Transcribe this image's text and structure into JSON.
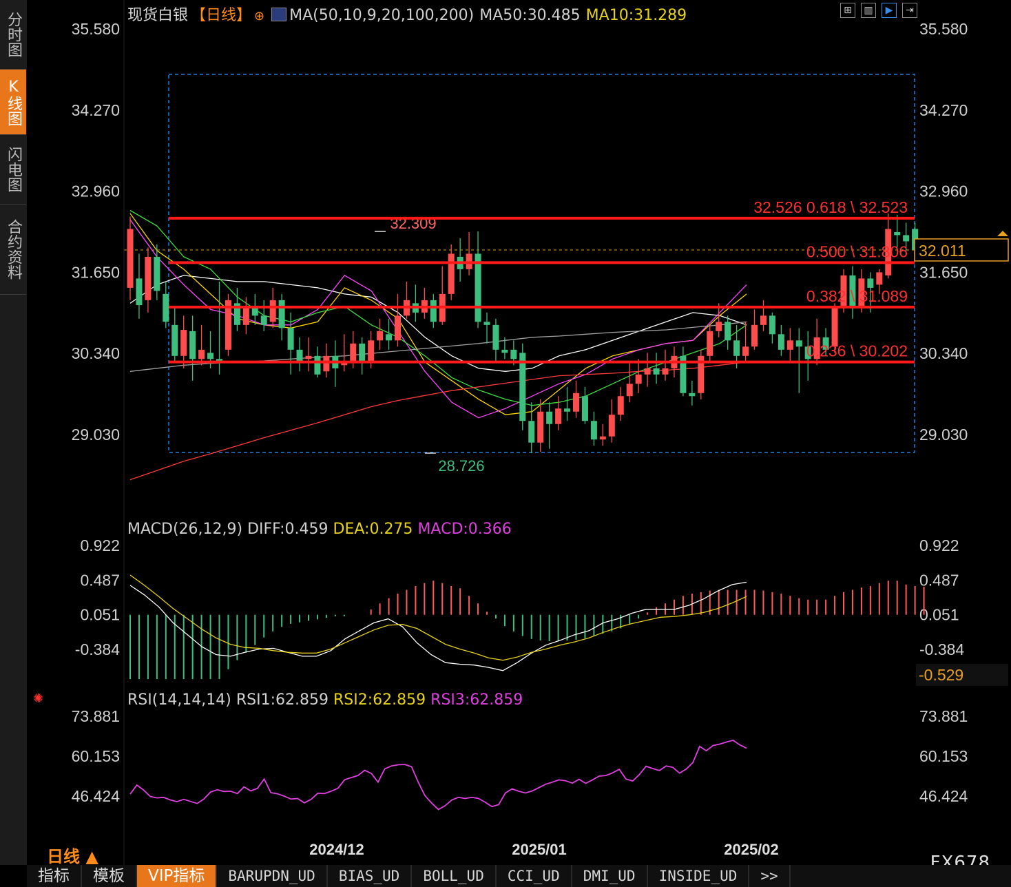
{
  "sidebar": {
    "tabs": [
      {
        "label": "分时图",
        "active": false
      },
      {
        "label": "K线图",
        "active": true
      },
      {
        "label": "闪电图",
        "active": false
      },
      {
        "label": "合约资料",
        "active": false
      }
    ]
  },
  "header": {
    "instrument": "现货白银",
    "period_bracket": "【日线】",
    "ma_params": "MA(50,10,9,20,100,200)",
    "ma50": "MA50:30.485",
    "ma10": "MA10:31.289"
  },
  "toolbar_icons": [
    "grid-icon",
    "bar-chart-icon",
    "play-icon",
    "step-forward-icon"
  ],
  "price_panel": {
    "y_ticks": [
      "35.580",
      "34.270",
      "32.960",
      "31.650",
      "30.340",
      "29.030"
    ],
    "current_price": "32.011",
    "high_label": "32.309",
    "low_label": "28.726",
    "fib_levels": [
      {
        "text": "32.526 0.618 \\ 32.523",
        "value": 32.523
      },
      {
        "text": "0.500 \\ 31.806",
        "value": 31.806
      },
      {
        "text": "0.382 \\ 31.089",
        "value": 31.089
      },
      {
        "text": "0.236 \\ 30.202",
        "value": 30.202
      }
    ],
    "colors": {
      "up": "#ff4d4d",
      "down": "#3fbf7f",
      "fib": "#ff1a1a",
      "frame": "#1f7fe0"
    }
  },
  "macd_panel": {
    "title": "MACD(26,12,9)",
    "diff": "DIFF:0.459",
    "dea": "DEA:0.275",
    "macd": "MACD:0.366",
    "y_ticks": [
      "0.922",
      "0.487",
      "0.051",
      "-0.384"
    ],
    "readout": "-0.529"
  },
  "rsi_panel": {
    "title": "RSI(14,14,14)",
    "rsi1": "RSI1:62.859",
    "rsi2": "RSI2:62.859",
    "rsi3": "RSI3:62.859",
    "y_ticks": [
      "73.881",
      "60.153",
      "46.424"
    ]
  },
  "x_labels": [
    "2024/12",
    "2025/01",
    "2025/02"
  ],
  "period_label": "日线 ▲",
  "bottom_tabs": [
    "指标",
    "模板",
    "VIP指标",
    "BARUPDN_UD",
    "BIAS_UD",
    "BOLL_UD",
    "CCI_UD",
    "DMI_UD",
    "INSIDE_UD",
    ">>"
  ],
  "watermark": "FX678",
  "chart_data": {
    "type": "candlestick",
    "ylim": [
      28.3,
      35.8
    ],
    "candles": [
      [
        31.4,
        32.35,
        32.55,
        31.2
      ],
      [
        31.55,
        31.12,
        31.95,
        30.9
      ],
      [
        31.2,
        31.9,
        32.05,
        31.0
      ],
      [
        31.9,
        31.35,
        32.1,
        31.2
      ],
      [
        31.3,
        30.85,
        31.5,
        30.75
      ],
      [
        30.8,
        30.3,
        31.1,
        30.2
      ],
      [
        30.3,
        30.72,
        30.95,
        30.1
      ],
      [
        30.7,
        30.25,
        30.95,
        29.9
      ],
      [
        30.25,
        30.4,
        30.8,
        30.15
      ],
      [
        30.35,
        30.25,
        30.7,
        30.1
      ],
      [
        30.25,
        30.2,
        31.5,
        30.0
      ],
      [
        30.4,
        31.2,
        31.3,
        30.3
      ],
      [
        31.15,
        30.8,
        31.4,
        30.7
      ],
      [
        30.8,
        31.1,
        31.25,
        30.65
      ],
      [
        31.1,
        30.95,
        31.3,
        30.8
      ],
      [
        30.95,
        30.8,
        31.2,
        30.7
      ],
      [
        30.85,
        31.2,
        31.4,
        30.75
      ],
      [
        31.2,
        30.75,
        31.3,
        30.55
      ],
      [
        30.75,
        30.4,
        31.0,
        30.0
      ],
      [
        30.4,
        30.2,
        30.6,
        30.05
      ],
      [
        30.25,
        30.3,
        30.6,
        30.05
      ],
      [
        30.3,
        30.0,
        30.45,
        29.95
      ],
      [
        30.05,
        30.3,
        30.5,
        29.95
      ],
      [
        30.3,
        30.1,
        30.55,
        29.8
      ],
      [
        30.15,
        30.2,
        30.65,
        30.05
      ],
      [
        30.2,
        30.5,
        30.7,
        30.1
      ],
      [
        30.5,
        30.2,
        30.6,
        30.0
      ],
      [
        30.2,
        30.55,
        30.7,
        30.1
      ],
      [
        30.55,
        30.7,
        30.9,
        30.4
      ],
      [
        30.65,
        30.55,
        30.9,
        30.4
      ],
      [
        30.55,
        30.95,
        31.3,
        30.45
      ],
      [
        30.95,
        31.2,
        31.5,
        30.9
      ],
      [
        31.15,
        31.0,
        31.45,
        30.85
      ],
      [
        31.0,
        31.2,
        31.4,
        30.9
      ],
      [
        31.2,
        30.85,
        31.3,
        30.75
      ],
      [
        30.85,
        31.3,
        31.75,
        30.8
      ],
      [
        31.3,
        31.95,
        32.1,
        31.2
      ],
      [
        31.9,
        31.7,
        32.2,
        31.5
      ],
      [
        31.7,
        31.95,
        32.3,
        31.6
      ],
      [
        31.95,
        30.85,
        32.31,
        30.75
      ],
      [
        30.85,
        30.8,
        31.0,
        30.5
      ],
      [
        30.8,
        30.4,
        30.9,
        30.2
      ],
      [
        30.4,
        30.35,
        30.6,
        30.25
      ],
      [
        30.4,
        30.25,
        30.55,
        30.15
      ],
      [
        30.35,
        29.25,
        30.5,
        29.1
      ],
      [
        29.25,
        28.9,
        29.55,
        28.73
      ],
      [
        28.9,
        29.4,
        29.6,
        28.75
      ],
      [
        29.4,
        29.2,
        29.55,
        28.8
      ],
      [
        29.2,
        29.45,
        29.65,
        29.1
      ],
      [
        29.45,
        29.4,
        29.8,
        29.25
      ],
      [
        29.4,
        29.7,
        29.9,
        29.3
      ],
      [
        29.65,
        29.25,
        29.8,
        29.2
      ],
      [
        29.25,
        28.95,
        29.4,
        28.85
      ],
      [
        28.95,
        29.0,
        29.2,
        28.85
      ],
      [
        29.0,
        29.35,
        29.6,
        28.9
      ],
      [
        29.35,
        29.65,
        29.8,
        29.25
      ],
      [
        29.65,
        29.85,
        30.2,
        29.55
      ],
      [
        29.85,
        30.0,
        30.25,
        29.7
      ],
      [
        30.0,
        30.1,
        30.35,
        29.8
      ],
      [
        30.1,
        30.0,
        30.35,
        29.85
      ],
      [
        30.0,
        30.1,
        30.4,
        29.9
      ],
      [
        30.1,
        30.3,
        30.45,
        29.95
      ],
      [
        30.3,
        29.7,
        30.45,
        29.65
      ],
      [
        29.7,
        29.65,
        29.9,
        29.5
      ],
      [
        29.7,
        30.3,
        30.4,
        29.6
      ],
      [
        30.3,
        30.7,
        30.8,
        30.2
      ],
      [
        30.7,
        30.85,
        31.15,
        30.6
      ],
      [
        30.85,
        30.55,
        30.95,
        30.4
      ],
      [
        30.55,
        30.3,
        30.8,
        30.1
      ],
      [
        30.3,
        30.45,
        30.85,
        30.2
      ],
      [
        30.45,
        30.8,
        31.05,
        30.4
      ],
      [
        30.8,
        30.95,
        31.2,
        30.7
      ],
      [
        30.95,
        30.65,
        31.0,
        30.5
      ],
      [
        30.65,
        30.4,
        30.8,
        30.3
      ],
      [
        30.4,
        30.55,
        30.75,
        30.2
      ],
      [
        30.55,
        30.45,
        30.75,
        29.7
      ],
      [
        30.45,
        30.25,
        30.7,
        29.9
      ],
      [
        30.25,
        30.6,
        30.9,
        30.15
      ],
      [
        30.6,
        30.4,
        30.75,
        30.3
      ],
      [
        30.45,
        31.1,
        31.15,
        30.35
      ],
      [
        31.1,
        31.6,
        31.7,
        31.0
      ],
      [
        31.6,
        31.1,
        31.75,
        30.9
      ],
      [
        31.1,
        31.55,
        31.7,
        31.0
      ],
      [
        31.55,
        31.4,
        31.65,
        31.0
      ],
      [
        31.45,
        31.65,
        31.7,
        31.3
      ],
      [
        31.6,
        32.35,
        32.6,
        31.55
      ],
      [
        32.3,
        32.25,
        32.58,
        32.05
      ],
      [
        32.25,
        32.15,
        32.45,
        32.0
      ],
      [
        32.35,
        32.01,
        32.45,
        31.85
      ]
    ],
    "ma_series": [
      {
        "color": "#ffffff",
        "values": [
          31.15,
          31.45,
          31.6,
          31.55,
          31.5,
          31.5,
          31.45,
          31.4,
          31.3,
          31.25,
          31.0,
          30.6,
          30.3,
          30.1,
          30.05,
          30.1,
          30.3,
          30.4,
          30.55,
          30.7,
          30.85,
          31.0,
          30.95,
          30.8
        ]
      },
      {
        "color": "#ffd700",
        "values": [
          32.6,
          32.0,
          31.7,
          31.3,
          30.9,
          30.8,
          30.75,
          30.85,
          31.4,
          31.2,
          30.9,
          30.2,
          29.9,
          29.6,
          29.35,
          29.4,
          29.75,
          30.1,
          30.3,
          30.4,
          30.5,
          30.55,
          30.95,
          31.3
        ]
      },
      {
        "color": "#ff44ff",
        "values": [
          32.5,
          31.9,
          31.45,
          31.05,
          30.95,
          30.8,
          30.8,
          31.05,
          31.6,
          31.35,
          30.7,
          30.05,
          29.55,
          29.3,
          29.45,
          29.65,
          29.85,
          30.0,
          30.25,
          30.4,
          30.5,
          30.55,
          31.0,
          31.45
        ]
      },
      {
        "color": "#3fdf3f",
        "values": [
          32.65,
          32.4,
          31.9,
          31.7,
          31.25,
          30.95,
          30.85,
          31.0,
          31.1,
          30.8,
          30.6,
          30.3,
          29.95,
          29.75,
          29.6,
          29.5,
          29.55,
          29.65,
          29.85,
          30.05,
          30.2,
          30.35,
          30.5,
          30.8
        ]
      },
      {
        "color": "#a0a0a0",
        "values": [
          30.05,
          30.1,
          30.15,
          30.18,
          30.2,
          30.22,
          30.25,
          30.28,
          30.3,
          30.34,
          30.38,
          30.42,
          30.46,
          30.5,
          30.55,
          30.6,
          30.62,
          30.65,
          30.68,
          30.7,
          30.72,
          30.76,
          30.8,
          30.85
        ]
      },
      {
        "color": "#ff3a3a",
        "values": [
          28.3,
          28.45,
          28.6,
          28.72,
          28.85,
          28.98,
          29.1,
          29.22,
          29.35,
          29.48,
          29.58,
          29.66,
          29.74,
          29.8,
          29.86,
          29.92,
          29.98,
          30.0,
          30.02,
          30.05,
          30.07,
          30.1,
          30.15,
          30.2
        ]
      }
    ],
    "macd_hist": [
      -0.85,
      -0.85,
      -0.85,
      -0.85,
      -0.85,
      -0.85,
      -0.85,
      -0.85,
      -0.85,
      -0.85,
      -0.85,
      -0.72,
      -0.6,
      -0.5,
      -0.4,
      -0.3,
      -0.22,
      -0.16,
      -0.12,
      -0.1,
      -0.08,
      -0.06,
      -0.04,
      -0.02,
      -0.02,
      0.0,
      0.0,
      0.07,
      0.15,
      0.22,
      0.28,
      0.33,
      0.38,
      0.42,
      0.45,
      0.42,
      0.38,
      0.35,
      0.25,
      0.15,
      0.04,
      -0.05,
      -0.15,
      -0.22,
      -0.28,
      -0.32,
      -0.34,
      -0.35,
      -0.35,
      -0.34,
      -0.33,
      -0.31,
      -0.28,
      -0.25,
      -0.22,
      -0.18,
      -0.12,
      -0.05,
      0.03,
      0.1,
      0.15,
      0.2,
      0.25,
      0.28,
      0.3,
      0.32,
      0.33,
      0.33,
      0.33,
      0.33,
      0.33,
      0.32,
      0.3,
      0.28,
      0.25,
      0.22,
      0.2,
      0.2,
      0.2,
      0.25,
      0.3,
      0.33,
      0.36,
      0.38,
      0.42,
      0.45,
      0.45,
      0.4,
      0.38,
      0.37
    ],
    "macd_diff": [
      0.42,
      0.3,
      0.15,
      -0.05,
      -0.2,
      -0.35,
      -0.45,
      -0.47,
      -0.42,
      -0.38,
      -0.37,
      -0.42,
      -0.47,
      -0.47,
      -0.4,
      -0.25,
      -0.15,
      -0.05,
      0.0,
      -0.1,
      -0.3,
      -0.45,
      -0.55,
      -0.57,
      -0.58,
      -0.61,
      -0.65,
      -0.55,
      -0.43,
      -0.33,
      -0.27,
      -0.2,
      -0.15,
      -0.05,
      0.0,
      0.07,
      0.12,
      0.12,
      0.12,
      0.17,
      0.25,
      0.35,
      0.43,
      0.46
    ],
    "macd_dea": [
      0.55,
      0.42,
      0.28,
      0.13,
      0.0,
      -0.13,
      -0.24,
      -0.32,
      -0.36,
      -0.37,
      -0.4,
      -0.42,
      -0.43,
      -0.43,
      -0.38,
      -0.3,
      -0.22,
      -0.14,
      -0.08,
      -0.07,
      -0.12,
      -0.22,
      -0.32,
      -0.38,
      -0.43,
      -0.49,
      -0.52,
      -0.48,
      -0.42,
      -0.38,
      -0.33,
      -0.29,
      -0.24,
      -0.17,
      -0.11,
      -0.06,
      -0.02,
      0.02,
      0.03,
      0.05,
      0.08,
      0.13,
      0.2,
      0.28
    ],
    "rsi": [
      47.1,
      50.2,
      48.5,
      46.3,
      45.8,
      46.0,
      45.1,
      44.5,
      45.3,
      44.6,
      43.9,
      45.4,
      47.8,
      48.6,
      48.0,
      48.1,
      47.3,
      49.6,
      48.2,
      49.1,
      52.3,
      47.6,
      47.2,
      46.4,
      45.4,
      45.6,
      44.1,
      45.3,
      47.4,
      47.3,
      48.1,
      49.1,
      52.0,
      52.8,
      53.5,
      55.3,
      54.2,
      51.2,
      55.8,
      56.8,
      57.2,
      57.3,
      56.5,
      51.2,
      46.6,
      44.0,
      41.8,
      43.1,
      45.1,
      46.0,
      45.6,
      46.0,
      45.6,
      44.3,
      42.8,
      43.5,
      47.5,
      48.9,
      48.1,
      47.5,
      48.2,
      49.3,
      50.5,
      51.2,
      52.0,
      51.7,
      50.9,
      52.2,
      50.8,
      52.0,
      53.3,
      53.5,
      54.4,
      55.6,
      52.3,
      51.6,
      53.8,
      56.7,
      55.9,
      55.2,
      56.8,
      56.3,
      54.3,
      55.7,
      58.0,
      63.5,
      62.0,
      63.8,
      64.3,
      65.0,
      65.6,
      64.0,
      62.9
    ]
  }
}
